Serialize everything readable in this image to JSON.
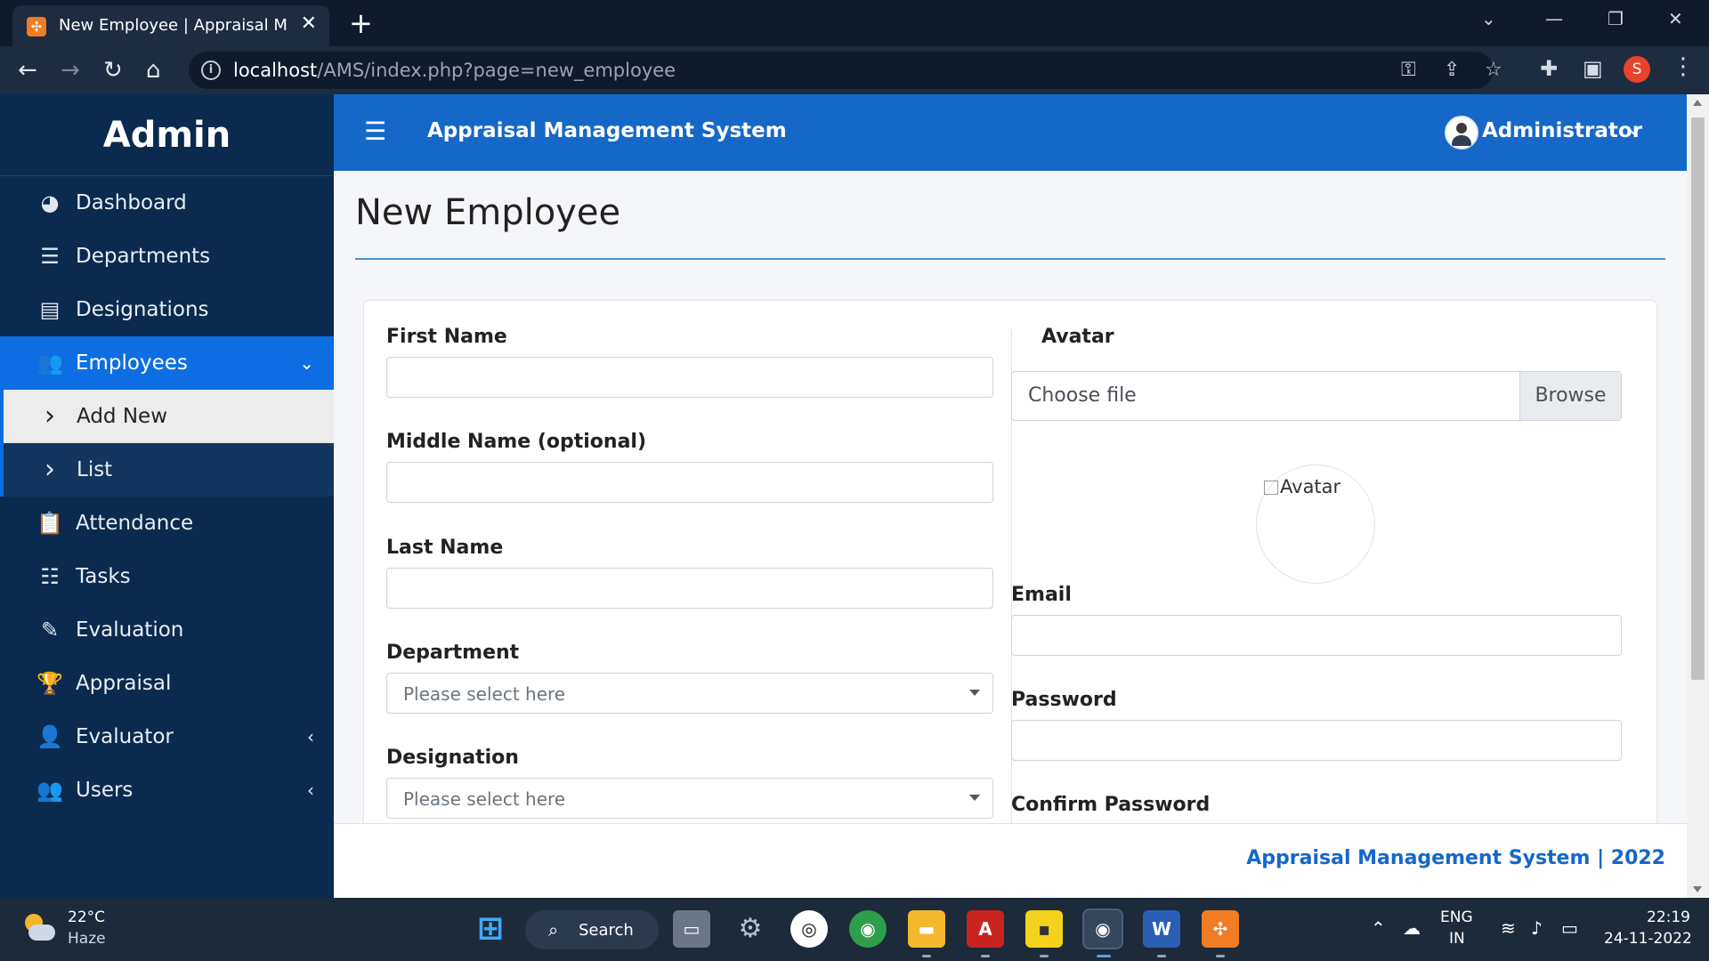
{
  "browser": {
    "tab_title": "New Employee | Appraisal Management System",
    "url_host": "localhost",
    "url_path": "/AMS/index.php?page=new_employee",
    "favicon_icon": "xampp-icon",
    "profile_initial": "S"
  },
  "sidebar": {
    "brand": "Admin",
    "items": [
      {
        "label": "Dashboard",
        "icon": "dashboard-icon",
        "glyph": "◕"
      },
      {
        "label": "Departments",
        "icon": "list-icon",
        "glyph": "☰"
      },
      {
        "label": "Designations",
        "icon": "list-alt-icon",
        "glyph": "▤"
      },
      {
        "label": "Employees",
        "icon": "users-icon",
        "glyph": "👥"
      },
      {
        "label": "Add New",
        "icon": "chevron-right-icon",
        "glyph": "›"
      },
      {
        "label": "List",
        "icon": "chevron-right-icon",
        "glyph": "›"
      },
      {
        "label": "Attendance",
        "icon": "clipboard-icon",
        "glyph": "📋"
      },
      {
        "label": "Tasks",
        "icon": "tasks-icon",
        "glyph": "☷"
      },
      {
        "label": "Evaluation",
        "icon": "edit-icon",
        "glyph": "✎"
      },
      {
        "label": "Appraisal",
        "icon": "trophy-icon",
        "glyph": "🏆"
      },
      {
        "label": "Evaluator",
        "icon": "user-tie-icon",
        "glyph": "👤"
      },
      {
        "label": "Users",
        "icon": "users-cog-icon",
        "glyph": "👥"
      }
    ]
  },
  "topbar": {
    "app_title": "Appraisal Management System",
    "user_name": "Administrator"
  },
  "page": {
    "title": "New Employee"
  },
  "form": {
    "first_name_label": "First Name",
    "first_name_value": "",
    "middle_name_label": "Middle Name (optional)",
    "middle_name_value": "",
    "last_name_label": "Last Name",
    "last_name_value": "",
    "department_label": "Department",
    "department_placeholder": "Please select here",
    "designation_label": "Designation",
    "designation_placeholder": "Please select here",
    "avatar_label": "Avatar",
    "avatar_choose": "Choose file",
    "avatar_browse": "Browse",
    "avatar_alt": "Avatar",
    "email_label": "Email",
    "email_value": "",
    "password_label": "Password",
    "password_value": "",
    "confirm_password_label": "Confirm Password"
  },
  "footer": {
    "text": "Appraisal Management System | 2022"
  },
  "taskbar": {
    "weather_temp": "22°C",
    "weather_desc": "Haze",
    "search_label": "Search",
    "lang_top": "ENG",
    "lang_bottom": "IN",
    "time": "22:19",
    "date": "24-11-2022"
  },
  "colors": {
    "sidebar_bg": "#0a2b4f",
    "accent": "#1568c8",
    "active_item": "#0d6ee3"
  }
}
